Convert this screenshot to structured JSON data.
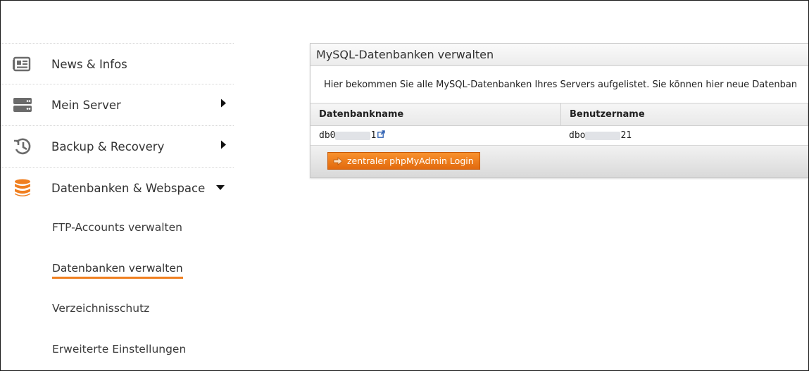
{
  "sidebar": {
    "items": [
      {
        "label": "News & Infos",
        "icon": "news-icon"
      },
      {
        "label": "Mein Server",
        "icon": "server-icon"
      },
      {
        "label": "Backup & Recovery",
        "icon": "history-icon"
      },
      {
        "label": "Datenbanken & Webspace",
        "icon": "database-icon"
      }
    ],
    "subitems": [
      {
        "label": "FTP-Accounts verwalten"
      },
      {
        "label": "Datenbanken verwalten",
        "active": true
      },
      {
        "label": "Verzeichnisschutz"
      },
      {
        "label": "Erweiterte Einstellungen"
      }
    ]
  },
  "panel": {
    "title": "MySQL-Datenbanken verwalten",
    "description": "Hier bekommen Sie alle MySQL-Datenbanken Ihres Servers aufgelistet. Sie können hier neue Datenban",
    "columns": [
      "Datenbankname",
      "Benutzername"
    ],
    "rows": [
      {
        "db_prefix": "db0",
        "db_suffix": "1",
        "user_prefix": "dbo",
        "user_suffix": "21"
      }
    ],
    "button_label": "zentraler phpMyAdmin Login"
  },
  "colors": {
    "accent": "#f07f20",
    "button": "#f07f20",
    "icon_gray": "#6b6b6b",
    "icon_db": "#f07f20"
  }
}
